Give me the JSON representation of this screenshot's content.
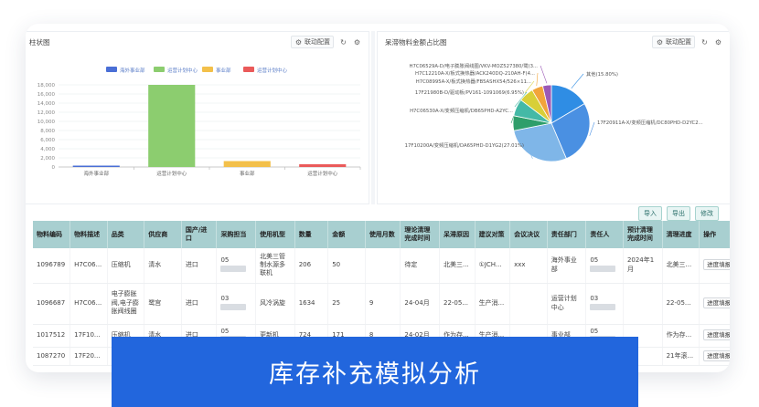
{
  "left_panel": {
    "title": "柱状图",
    "config_label": "联动配置",
    "chart_data": {
      "type": "bar",
      "categories": [
        "海外事业部",
        "运营计划中心",
        "事业部",
        "运营计划中心"
      ],
      "legend": [
        "海外事业部",
        "运营计划中心",
        "事业部",
        "运营计划中心"
      ],
      "values": [
        300,
        18000,
        1300,
        600
      ],
      "colors": [
        "#4a6fd6",
        "#8ccd6f",
        "#f3c04a",
        "#ea5a5a"
      ],
      "yticks": [
        "0",
        "2,000",
        "4,000",
        "6,000",
        "8,000",
        "10,000",
        "12,000",
        "14,000",
        "16,000",
        "18,000"
      ],
      "ylim": [
        0,
        18000
      ]
    }
  },
  "right_panel": {
    "title": "呆滞物料金额占比图",
    "config_label": "联动配置",
    "chart_data": {
      "type": "pie",
      "slices": [
        {
          "label": "其他(15.80%)",
          "value": 15.8,
          "color": "#2f8de4"
        },
        {
          "label": "17F20911A-X/变频压缩机/DC80PHD-D2YC2...",
          "value": 26,
          "color": "#4a90e2"
        },
        {
          "label": "17F10200A/变频压缩机/DA65PHD-D1YG2(27.01%)",
          "value": 27.01,
          "color": "#7fb6e8"
        },
        {
          "label": "H7C06530A-X/变频压缩机/DB65PHD-A2YC...",
          "value": 6,
          "color": "#2e9e6a"
        },
        {
          "label": "17F21980B-D/驱动板/PV161-1091069(6.95%)",
          "value": 6.95,
          "color": "#44b9a6"
        },
        {
          "label": "H7C08995A-X/板式换热器/FB5ASHX54/526×11...",
          "value": 6,
          "color": "#d8cf38"
        },
        {
          "label": "H7C12210A-X/板式换热器/ACK240DQ-210AH-F(4...",
          "value": 4.5,
          "color": "#f2a43a"
        },
        {
          "label": "H7C06529A-D/电子膨胀阀线圈/VKV-MOZ527380/鹭(3...",
          "value": 3.5,
          "color": "#9b59b6"
        }
      ]
    }
  },
  "actions": [
    "导入",
    "导出",
    "修改"
  ],
  "table": {
    "headers": [
      "物料编码",
      "物料描述",
      "品类",
      "供应商",
      "国产/进口",
      "采购担当",
      "使用机型",
      "数量",
      "金额",
      "使用月数",
      "理论清理完成时间",
      "呆滞原因",
      "建议对策",
      "会议决议",
      "责任部门",
      "责任人",
      "预计清理完成时间",
      "清理进度",
      "操作"
    ],
    "rows": [
      [
        "1096789",
        "H7C06...",
        "压缩机",
        "清水",
        "进口",
        "05",
        "北美三管制水源多联机",
        "206",
        "50",
        "",
        "待定",
        "北美三...",
        "①JCH...",
        "xxx",
        "海外事业部",
        "05",
        "2024年1月",
        "北美三...",
        "进度填报"
      ],
      [
        "1096687",
        "H7C06...",
        "电子膨胀阀,电子膨胀阀线圈",
        "鹭宫",
        "进口",
        "03",
        "风冷涡旋",
        "1634",
        "25",
        "9",
        "24-04月",
        "22-05...",
        "生产消...",
        "",
        "运营计划中心",
        "03",
        "",
        "22-05...",
        "进度填报"
      ],
      [
        "1017512",
        "17F10...",
        "压缩机",
        "清水",
        "进口",
        "05",
        "更新机",
        "724",
        "171",
        "8",
        "24-02月",
        "作为存...",
        "生产消...",
        "",
        "事业部",
        "05",
        "",
        "作为存...",
        "进度填报"
      ],
      [
        "1087270",
        "17F20...",
        "",
        "",
        "",
        "",
        "",
        "",
        "",
        "",
        "",
        "",
        "",
        "",
        "",
        "",
        "",
        "21年滚...",
        "进度填报"
      ]
    ]
  },
  "banner": "库存补充模拟分析"
}
